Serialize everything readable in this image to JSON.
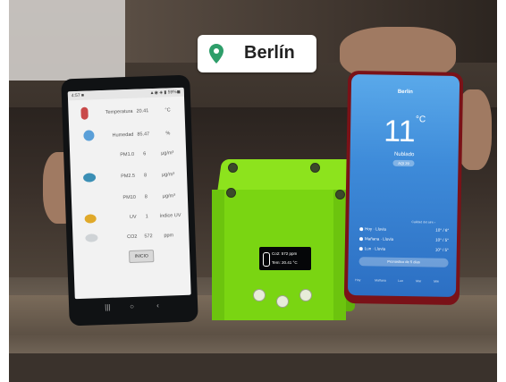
{
  "location_badge": {
    "city": "Berlín",
    "pin_color": "#2e9e6a"
  },
  "left_phone": {
    "status_time": "4:57 ■",
    "status_icons": "▲◉ ◈ ▮ 59%◼",
    "rows": [
      {
        "label": "Temperatura",
        "value": "20.41",
        "unit": "°C"
      },
      {
        "label": "Humedad",
        "value": "85.47",
        "unit": "%"
      },
      {
        "label": "PM1.0",
        "value": "6",
        "unit": "µg/m³"
      },
      {
        "label": "PM2.5",
        "value": "8",
        "unit": "µg/m³"
      },
      {
        "label": "PM10",
        "value": "8",
        "unit": "µg/m³"
      },
      {
        "label": "UV",
        "value": "1",
        "unit": "índice UV"
      },
      {
        "label": "CO2",
        "value": "572",
        "unit": "ppm"
      }
    ],
    "button_label": "INICIO",
    "nav": {
      "recent": "|||",
      "home": "○",
      "back": "‹"
    }
  },
  "device": {
    "oled_line1": "Co2: 572 ppm",
    "oled_line2": "Tem: 20.41 °C"
  },
  "right_phone": {
    "city": "Berlín",
    "temperature": "11",
    "temperature_unit": "°C",
    "condition": "Nublado",
    "aqi_pill": "AQI 29",
    "forecast_header": "Calidad del aire ›",
    "forecast": [
      {
        "day": "Hoy · Lluvia",
        "range": "10° / 6°"
      },
      {
        "day": "Mañana · Lluvia",
        "range": "10° / 5°"
      },
      {
        "day": "Lun · Lluvia",
        "range": "10° / 5°"
      }
    ],
    "forecast_button": "Pronóstico de 5 días",
    "tabs": [
      "Hoy",
      "Mañana",
      "Lun",
      "Mar",
      "Mié"
    ]
  }
}
